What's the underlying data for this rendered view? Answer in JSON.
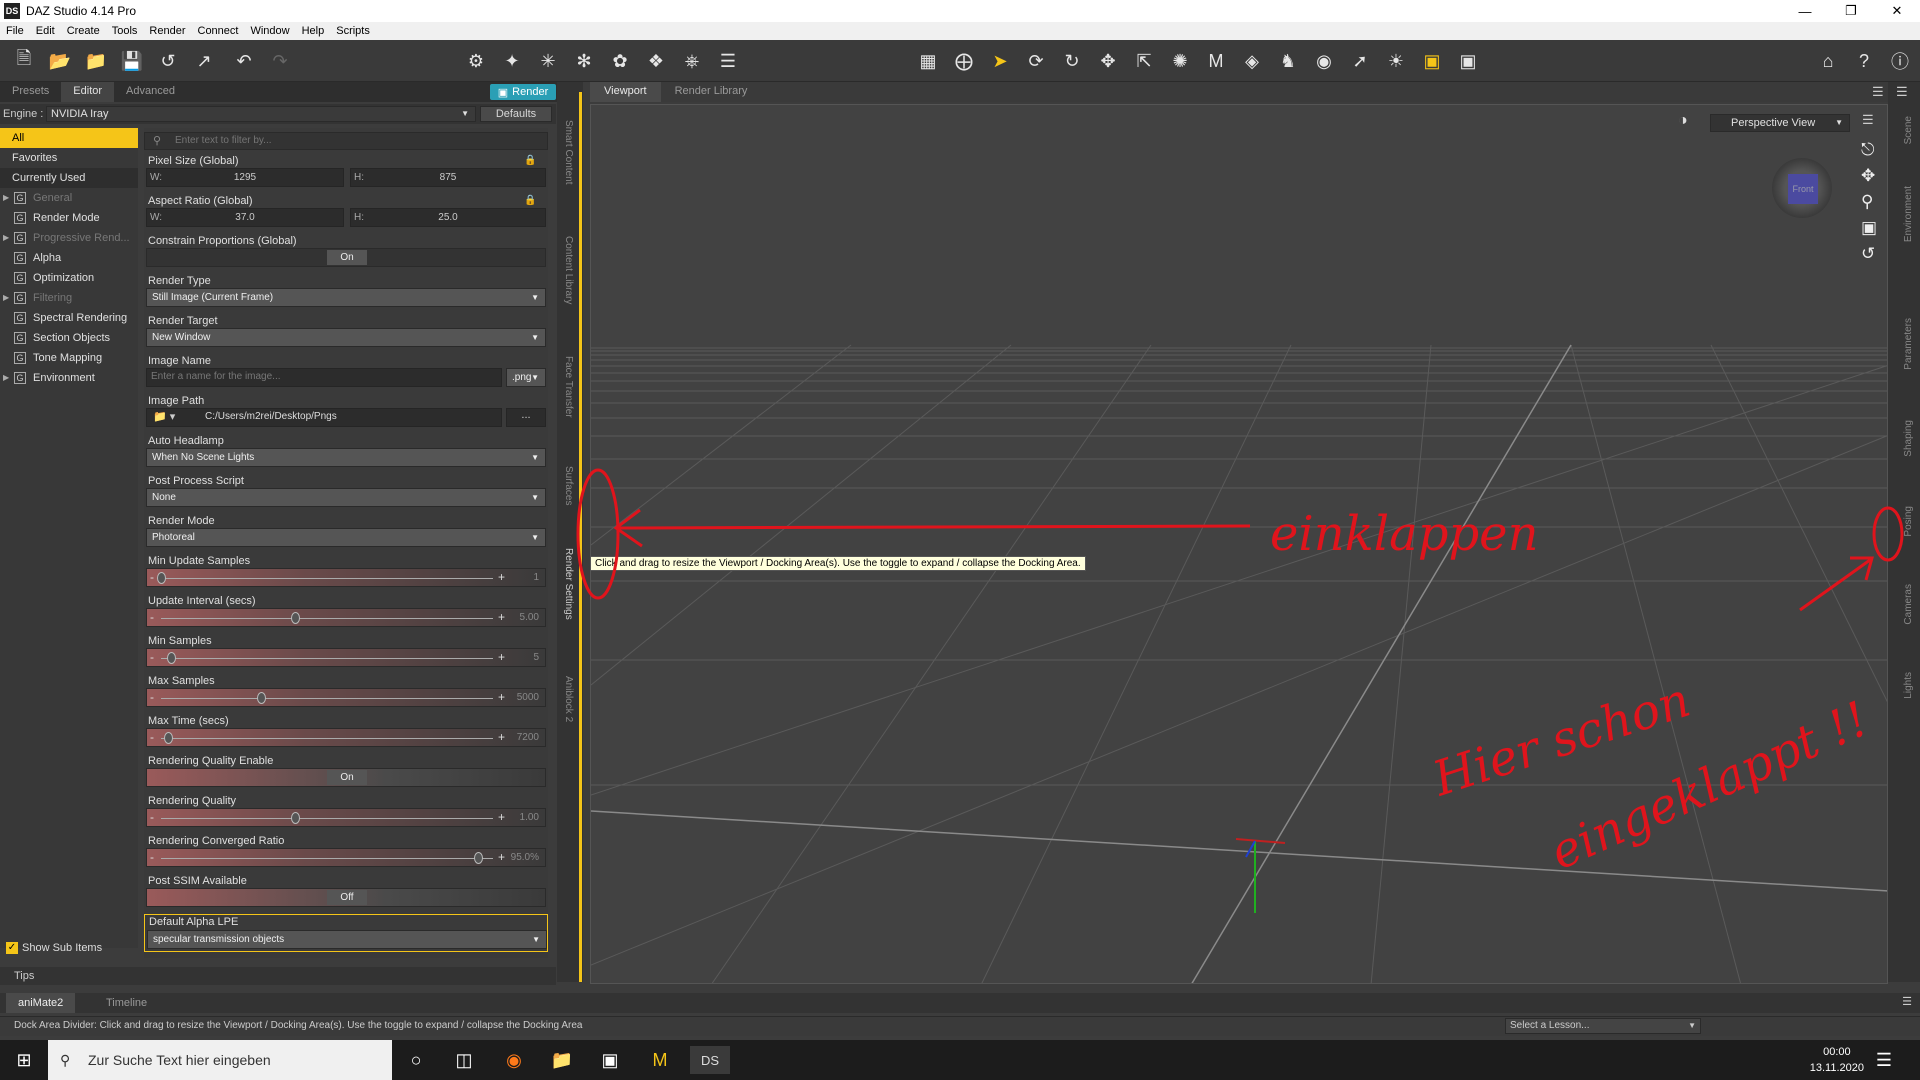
{
  "window": {
    "title": "DAZ Studio 4.14 Pro",
    "logo": "DS"
  },
  "menu": [
    "File",
    "Edit",
    "Create",
    "Tools",
    "Render",
    "Connect",
    "Window",
    "Help",
    "Scripts"
  ],
  "left_tabs": {
    "presets": "Presets",
    "editor": "Editor",
    "advanced": "Advanced",
    "render": "Render"
  },
  "engine": {
    "label": "Engine :",
    "value": "NVIDIA Iray",
    "defaults": "Defaults"
  },
  "categories": [
    {
      "label": "All",
      "selected": true
    },
    {
      "label": "Favorites"
    },
    {
      "label": "Currently Used"
    },
    {
      "label": "General",
      "disabled": true,
      "icon": "G"
    },
    {
      "label": "Render Mode",
      "icon": "G"
    },
    {
      "label": "Progressive Rend...",
      "disabled": true,
      "icon": "G"
    },
    {
      "label": "Alpha",
      "icon": "G"
    },
    {
      "label": "Optimization",
      "icon": "G"
    },
    {
      "label": "Filtering",
      "disabled": true,
      "icon": "G"
    },
    {
      "label": "Spectral Rendering",
      "icon": "G"
    },
    {
      "label": "Section Objects",
      "icon": "G"
    },
    {
      "label": "Tone Mapping",
      "icon": "G"
    },
    {
      "label": "Environment",
      "icon": "G"
    }
  ],
  "filter_placeholder": "Enter text to filter by...",
  "props": {
    "pixel_size": {
      "label": "Pixel Size (Global)",
      "w_label": "W:",
      "w": "1295",
      "h_label": "H:",
      "h": "875"
    },
    "aspect_ratio": {
      "label": "Aspect Ratio (Global)",
      "w_label": "W:",
      "w": "37.0",
      "h_label": "H:",
      "h": "25.0"
    },
    "constrain": {
      "label": "Constrain Proportions (Global)",
      "value": "On"
    },
    "render_type": {
      "label": "Render Type",
      "value": "Still Image (Current Frame)"
    },
    "render_target": {
      "label": "Render Target",
      "value": "New Window"
    },
    "image_name": {
      "label": "Image Name",
      "placeholder": "Enter a name for the image...",
      "ext": ".png"
    },
    "image_path": {
      "label": "Image Path",
      "value": "C:/Users/m2rei/Desktop/Pngs",
      "more": "..."
    },
    "auto_headlamp": {
      "label": "Auto Headlamp",
      "value": "When No Scene Lights"
    },
    "post_process": {
      "label": "Post Process Script",
      "value": "None"
    },
    "render_mode": {
      "label": "Render Mode",
      "value": "Photoreal"
    },
    "min_update_samples": {
      "label": "Min Update Samples",
      "value": "1",
      "fraction": 0.0
    },
    "update_interval": {
      "label": "Update Interval (secs)",
      "value": "5.00",
      "fraction": 0.4
    },
    "min_samples": {
      "label": "Min Samples",
      "value": "5",
      "fraction": 0.03
    },
    "max_samples": {
      "label": "Max Samples",
      "value": "5000",
      "fraction": 0.3
    },
    "max_time": {
      "label": "Max Time (secs)",
      "value": "7200",
      "fraction": 0.02
    },
    "rq_enable": {
      "label": "Rendering Quality Enable",
      "value": "On"
    },
    "rendering_quality": {
      "label": "Rendering Quality",
      "value": "1.00",
      "fraction": 0.4
    },
    "converged_ratio": {
      "label": "Rendering Converged Ratio",
      "value": "95.0%",
      "fraction": 0.95
    },
    "post_ssim": {
      "label": "Post SSIM Available",
      "value": "Off"
    },
    "default_alpha": {
      "label": "Default Alpha LPE",
      "value": "specular transmission objects"
    }
  },
  "show_sub_items": "Show Sub Items",
  "tips": "Tips",
  "side_tabs": [
    "Smart Content",
    "Content Library",
    "Face Transfer",
    "Surfaces",
    "Render Settings",
    "Aniblock 2"
  ],
  "viewport_tabs": {
    "viewport": "Viewport",
    "render_library": "Render Library"
  },
  "perspective": "Perspective View",
  "cube_face": "Front",
  "right_tabs": [
    "Scene",
    "Environment",
    "Parameters",
    "Shaping",
    "Posing",
    "Cameras",
    "Lights"
  ],
  "tooltip": "Click and drag to resize the Viewport / Docking Area(s). Use the toggle to expand / collapse the Docking Area.",
  "annotations": {
    "left": "einklappen",
    "right_1": "Hier schon",
    "right_2": "eingeklappt !!"
  },
  "bottom_tabs": {
    "animate": "aniMate2",
    "timeline": "Timeline"
  },
  "status": "Dock Area Divider: Click and drag to resize the Viewport / Docking Area(s). Use the toggle to expand / collapse the Docking Area",
  "lesson": "Select a Lesson...",
  "taskbar": {
    "search": "Zur Suche Text hier eingeben",
    "time": "00:00",
    "date": "13.11.2020"
  }
}
